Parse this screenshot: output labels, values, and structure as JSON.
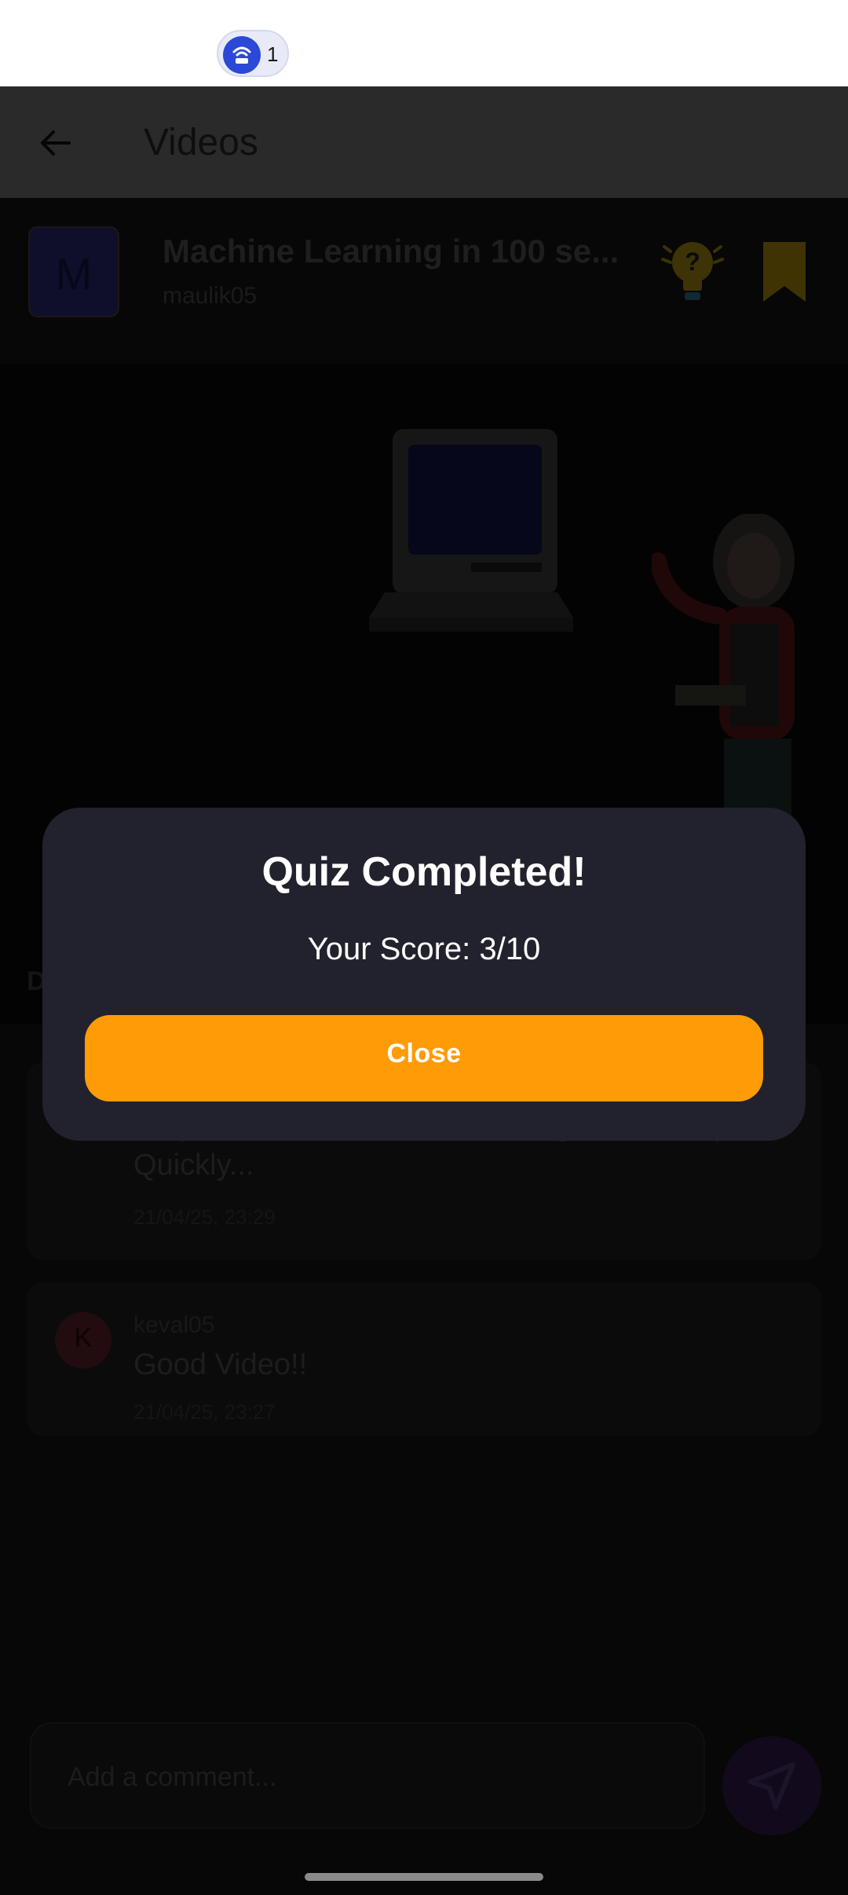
{
  "status_bar": {
    "hotspot_count": "1",
    "icons": [
      "hotspot-icon"
    ]
  },
  "app_bar": {
    "title": "Videos",
    "back_icon": "arrow-left-icon"
  },
  "video": {
    "channel_initial": "M",
    "title": "Machine Learning in 100 se...",
    "author": "maulik05",
    "quiz_icon": "lightbulb-question-icon",
    "bookmark_icon": "bookmark-icon"
  },
  "comments_heading": "D",
  "comments": [
    {
      "text": "Helped me a lot in understanding this concept Quickly...",
      "time": "21/04/25, 23:29"
    },
    {
      "initial": "K",
      "user": "keval05",
      "text": "Good Video!!",
      "time": "21/04/25, 23:27"
    }
  ],
  "comment_input": {
    "placeholder": "Add a comment..."
  },
  "send_icon": "send-icon",
  "dialog": {
    "title": "Quiz Completed!",
    "score": "Your Score: 3/10",
    "close_label": "Close"
  },
  "colors": {
    "accent": "#ff9b06",
    "dialog_bg": "#22222e",
    "bookmark": "#f6c20e",
    "hotspot": "#2b48d6"
  }
}
